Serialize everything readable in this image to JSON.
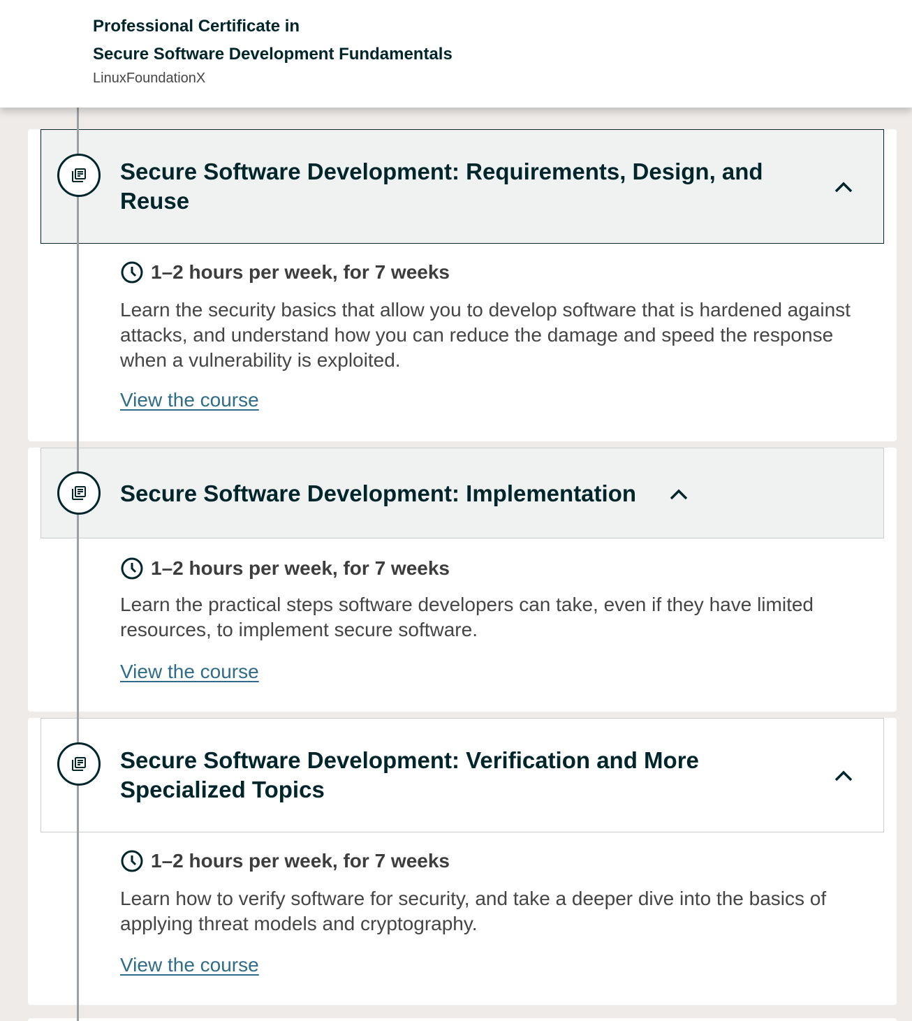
{
  "header": {
    "title_line1": "Professional Certificate in",
    "title_line2": "Secure Software Development Fundamentals",
    "org": "LinuxFoundationX"
  },
  "courses": [
    {
      "title": "Secure Software Development: Requirements, Design, and Reuse",
      "effort": "1–2 hours per week, for 7 weeks",
      "description": "Learn the security basics that allow you to develop software that is hardened against attacks, and understand how you can reduce the damage and speed the response when a vulnerability is exploited.",
      "link_label": "View the course"
    },
    {
      "title": "Secure Software Development: Implementation",
      "effort": "1–2 hours per week, for 7 weeks",
      "description": "Learn the practical steps software developers can take, even if they have limited resources, to implement secure software.",
      "link_label": "View the course"
    },
    {
      "title": "Secure Software Development: Verification and More Specialized Topics",
      "effort": "1–2 hours per week, for 7 weeks",
      "description": "Learn how to verify software for security, and take a deeper dive into the basics of applying threat models and cryptography.",
      "link_label": "View the course"
    }
  ],
  "icons": {
    "course": "course-book-icon",
    "effort": "clock-icon",
    "toggle": "chevron-up-icon"
  },
  "colors": {
    "primary_text": "#00262b",
    "link": "#2f6c89",
    "page_bg": "#eeebe9",
    "header_highlight": "#f0f2f2"
  }
}
